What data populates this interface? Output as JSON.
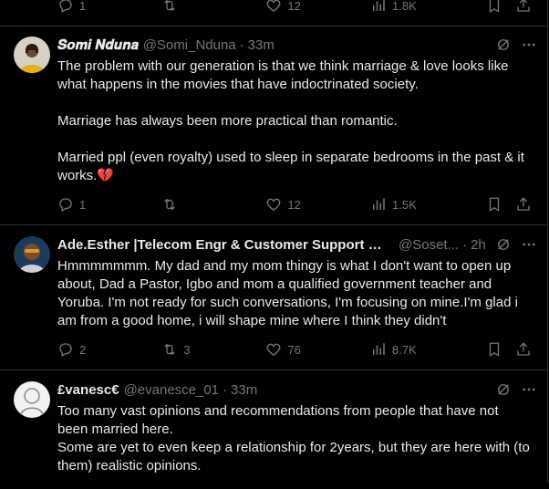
{
  "top_bar": {
    "reply_count": "1",
    "retweet_count": "",
    "like_count": "12",
    "view_count": "1.8K"
  },
  "tweets": [
    {
      "name": "𝑺𝒐𝒎𝒊 𝑵𝒅𝒖𝒏𝒂",
      "handle": "@Somi_Nduna",
      "dot": "·",
      "time": "33m",
      "paragraphs": [
        "The problem with our generation is that we think marriage & love looks like what happens in the movies that have indoctrinated society.",
        "Marriage has always been more practical than romantic.",
        "Married ppl (even royalty) used to sleep in separate bedrooms in the past & it works.💔"
      ],
      "reply_count": "1",
      "retweet_count": "",
      "like_count": "12",
      "view_count": "1.5K"
    },
    {
      "name": "Ade.Esther |Telecom Engr & Customer Support E...",
      "handle": "@Soset...",
      "dot": "·",
      "time": "2h",
      "paragraphs": [
        "Hmmmmmmm. My dad and my mom thingy is what I don't want to open up about, Dad a Pastor, Igbo and mom a qualified government teacher and Yoruba.  I'm not ready for such conversations, I'm focusing on mine.I'm glad i am from a good home, i will shape mine where I think they didn't"
      ],
      "reply_count": "2",
      "retweet_count": "3",
      "like_count": "76",
      "view_count": "8.7K"
    },
    {
      "name": "£vanesc€",
      "handle": "@evanesce_01",
      "dot": "·",
      "time": "33m",
      "paragraphs": [
        "Too many vast opinions and recommendations from people that have not been married here.",
        "Some are yet to even keep a relationship for 2years, but they are here with (to them) realistic opinions."
      ]
    }
  ],
  "colors": {
    "background": "#000000",
    "text": "#e7e9ea",
    "muted": "#71767b",
    "border": "#2f3336"
  }
}
